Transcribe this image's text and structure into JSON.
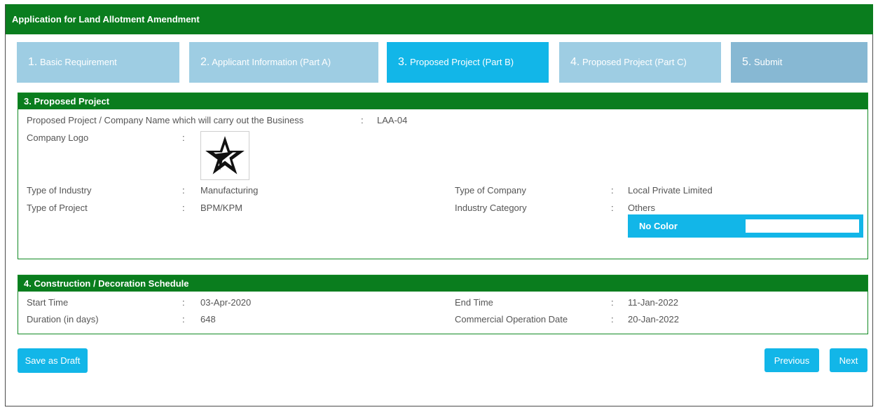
{
  "header": {
    "title": "Application for Land Allotment Amendment"
  },
  "steps": [
    {
      "num": "1.",
      "label": "Basic Requirement",
      "state": "inactive"
    },
    {
      "num": "2.",
      "label": "Applicant Information (Part A)",
      "state": "inactive"
    },
    {
      "num": "3.",
      "label": "Proposed Project (Part B)",
      "state": "active"
    },
    {
      "num": "4.",
      "label": "Proposed Project (Part C)",
      "state": "inactive"
    },
    {
      "num": "5.",
      "label": "Submit",
      "state": "inactive"
    }
  ],
  "project": {
    "title": "3. Proposed Project",
    "company_name_label": "Proposed Project / Company Name which will carry out the Business",
    "company_name_value": "LAA-04",
    "logo_label": "Company Logo",
    "industry_type_label": "Type of Industry",
    "industry_type_value": "Manufacturing",
    "project_type_label": "Type of Project",
    "project_type_value": "BPM/KPM",
    "company_type_label": "Type of Company",
    "company_type_value": "Local Private Limited",
    "industry_category_label": "Industry Category",
    "industry_category_value": "Others",
    "color_label": "No Color",
    "separator": ":"
  },
  "schedule": {
    "title": "4. Construction / Decoration Schedule",
    "start_label": "Start Time",
    "start_value": "03-Apr-2020",
    "duration_label": "Duration (in days)",
    "duration_value": "648",
    "end_label": "End Time",
    "end_value": "11-Jan-2022",
    "cod_label": "Commercial Operation Date",
    "cod_value": "20-Jan-2022",
    "separator": ":"
  },
  "buttons": {
    "save_draft": "Save as Draft",
    "previous": "Previous",
    "next": "Next"
  },
  "colors": {
    "header_green": "#0a7d1e",
    "step_active": "#12b6e8",
    "step_inactive": "#9ecde3",
    "step_submit": "#87b8d3",
    "button_blue": "#12b6e8"
  }
}
